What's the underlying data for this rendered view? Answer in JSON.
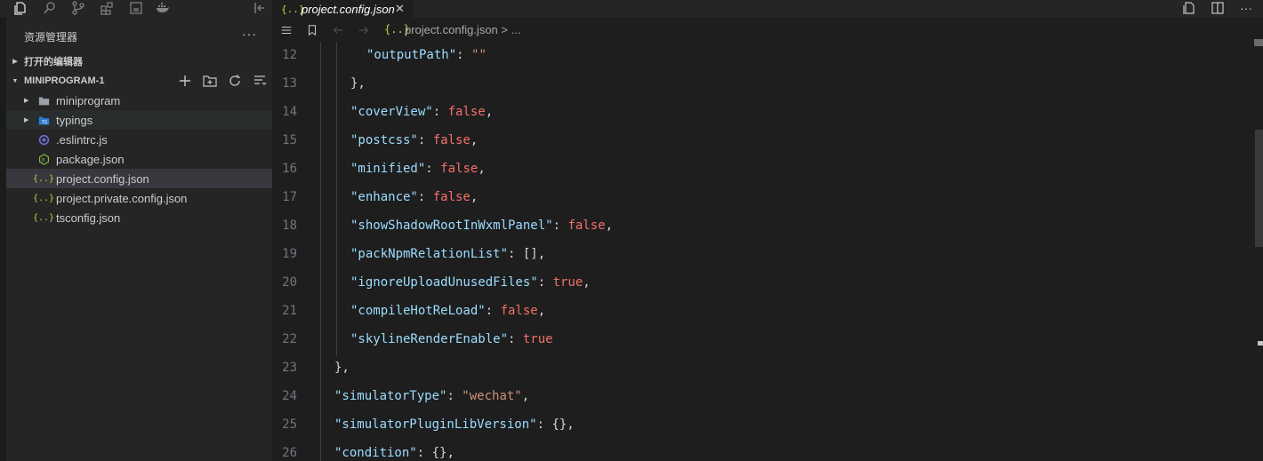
{
  "sidebar": {
    "title": "资源管理器",
    "more": "···",
    "open_editors": "打开的编辑器",
    "project": "MINIPROGRAM-1",
    "items": [
      {
        "label": "miniprogram",
        "type": "folder"
      },
      {
        "label": "typings",
        "type": "ts-folder"
      },
      {
        "label": ".eslintrc.js",
        "type": "eslint"
      },
      {
        "label": "package.json",
        "type": "npm"
      },
      {
        "label": "project.config.json",
        "type": "json"
      },
      {
        "label": "project.private.config.json",
        "type": "json"
      },
      {
        "label": "tsconfig.json",
        "type": "json"
      }
    ]
  },
  "tab": {
    "icon": "{..}",
    "label": "project.config.json",
    "close": "✕"
  },
  "breadcrumb": {
    "file_icon": "{..}",
    "path": "project.config.json > ..."
  },
  "code": {
    "lines": [
      {
        "n": "12",
        "indent": 3,
        "key": "\"outputPath\"",
        "sep": ": ",
        "val": "\"\"",
        "vt": "s",
        "end": ""
      },
      {
        "n": "13",
        "indent": 2,
        "key": "",
        "sep": "",
        "val": "},",
        "vt": "p",
        "end": ""
      },
      {
        "n": "14",
        "indent": 2,
        "key": "\"coverView\"",
        "sep": ": ",
        "val": "false",
        "vt": "b",
        "end": ","
      },
      {
        "n": "15",
        "indent": 2,
        "key": "\"postcss\"",
        "sep": ": ",
        "val": "false",
        "vt": "b",
        "end": ","
      },
      {
        "n": "16",
        "indent": 2,
        "key": "\"minified\"",
        "sep": ": ",
        "val": "false",
        "vt": "b",
        "end": ","
      },
      {
        "n": "17",
        "indent": 2,
        "key": "\"enhance\"",
        "sep": ": ",
        "val": "false",
        "vt": "b",
        "end": ","
      },
      {
        "n": "18",
        "indent": 2,
        "key": "\"showShadowRootInWxmlPanel\"",
        "sep": ": ",
        "val": "false",
        "vt": "b",
        "end": ","
      },
      {
        "n": "19",
        "indent": 2,
        "key": "\"packNpmRelationList\"",
        "sep": ": ",
        "val": "[]",
        "vt": "p",
        "end": ","
      },
      {
        "n": "20",
        "indent": 2,
        "key": "\"ignoreUploadUnusedFiles\"",
        "sep": ": ",
        "val": "true",
        "vt": "b",
        "end": ","
      },
      {
        "n": "21",
        "indent": 2,
        "key": "\"compileHotReLoad\"",
        "sep": ": ",
        "val": "false",
        "vt": "b",
        "end": ","
      },
      {
        "n": "22",
        "indent": 2,
        "key": "\"skylineRenderEnable\"",
        "sep": ": ",
        "val": "true",
        "vt": "b",
        "end": ""
      },
      {
        "n": "23",
        "indent": 1,
        "key": "",
        "sep": "",
        "val": "},",
        "vt": "p",
        "end": ""
      },
      {
        "n": "24",
        "indent": 1,
        "key": "\"simulatorType\"",
        "sep": ": ",
        "val": "\"wechat\"",
        "vt": "s",
        "end": ","
      },
      {
        "n": "25",
        "indent": 1,
        "key": "\"simulatorPluginLibVersion\"",
        "sep": ": ",
        "val": "{}",
        "vt": "p",
        "end": ","
      },
      {
        "n": "26",
        "indent": 1,
        "key": "\"condition\"",
        "sep": ": ",
        "val": "{}",
        "vt": "p",
        "end": ","
      }
    ]
  }
}
